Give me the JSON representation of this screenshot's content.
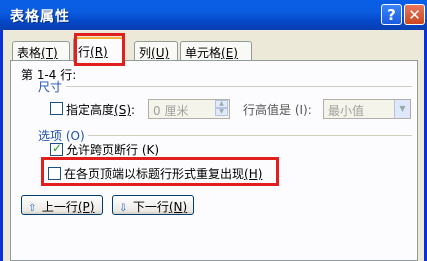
{
  "dialog": {
    "title": "表格属性",
    "help_label": "?",
    "close_label": "✕"
  },
  "tabs": [
    {
      "label": "表格",
      "key": "(T)"
    },
    {
      "label": "行",
      "key": "(R)"
    },
    {
      "label": "列",
      "key": "(U)"
    },
    {
      "label": "单元格",
      "key": "(E)"
    }
  ],
  "row_header": "第 1-4 行:",
  "size": {
    "section": "尺寸",
    "specify_height_label": "指定高度",
    "specify_height_key": "(S)",
    "height_value": "0 厘米",
    "row_height_label": "行高值是 (I):",
    "row_height_value": "最小值"
  },
  "options": {
    "section": "选项 (O)",
    "allow_break_label": "允许跨页断行 (K)",
    "repeat_header_label": "在各页顶端以标题行形式重复出现",
    "repeat_header_key": "(H)"
  },
  "buttons": {
    "prev": "上一行",
    "prev_key": "(P)",
    "next": "下一行",
    "next_key": "(N)"
  },
  "colors": {
    "title_bar": "#0a5fe6",
    "highlight": "#e21f1f",
    "tab_accent": "#f6b33c"
  }
}
